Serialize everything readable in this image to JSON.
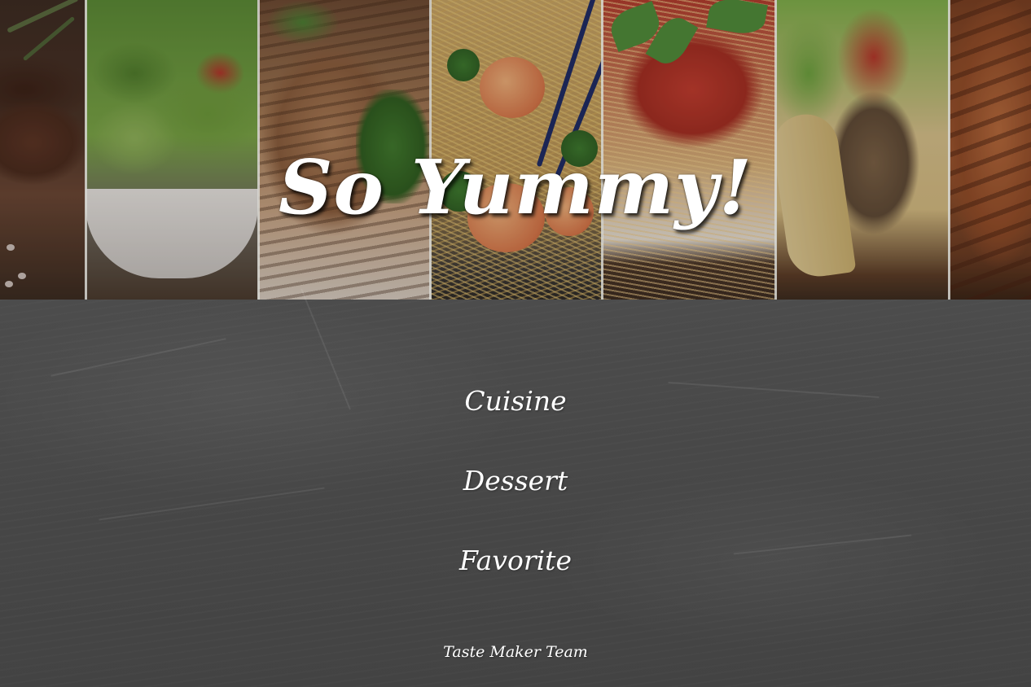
{
  "hero": {
    "title": "So Yummy!",
    "panels": [
      {
        "id": "steak",
        "image_icon": "steak-image"
      },
      {
        "id": "salad",
        "image_icon": "salad-image"
      },
      {
        "id": "fish",
        "image_icon": "grilled-fish-image"
      },
      {
        "id": "noodles",
        "image_icon": "shrimp-noodles-image"
      },
      {
        "id": "spaghetti",
        "image_icon": "spaghetti-image"
      },
      {
        "id": "tacos",
        "image_icon": "tacos-image"
      },
      {
        "id": "chicken",
        "image_icon": "grilled-chicken-image"
      }
    ]
  },
  "nav": {
    "items": [
      {
        "label": "Cuisine"
      },
      {
        "label": "Dessert"
      },
      {
        "label": "Favorite"
      }
    ]
  },
  "footer": {
    "text": "Taste Maker Team"
  },
  "colors": {
    "chalkboard": "#4b4b4b",
    "text": "#ffffff"
  }
}
